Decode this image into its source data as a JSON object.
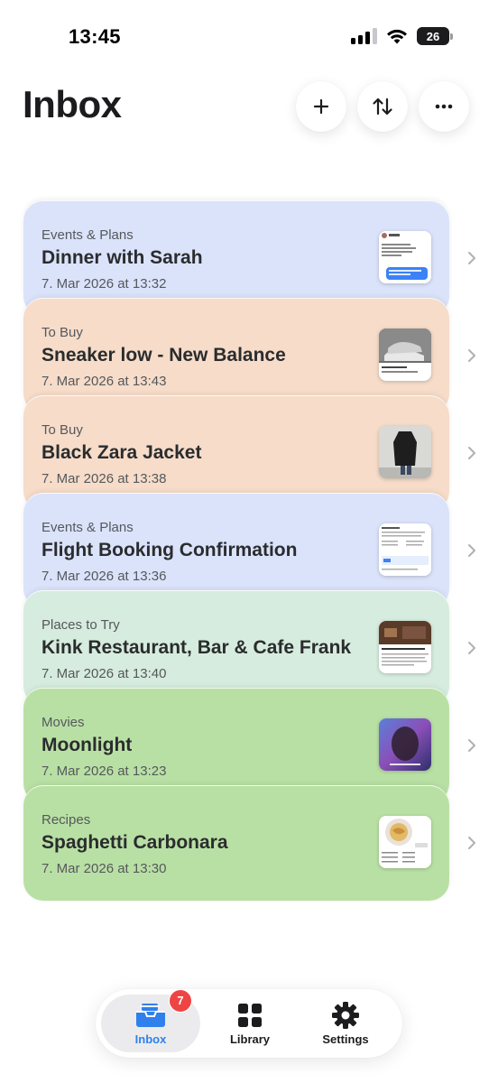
{
  "status_bar": {
    "time": "13:45",
    "battery": "26"
  },
  "header": {
    "title": "Inbox"
  },
  "items": [
    {
      "category": "Events & Plans",
      "title": "Dinner with Sarah",
      "date": "7. Mar 2026 at 13:32",
      "color": "#dbe3fb",
      "thumb": "chat-screenshot"
    },
    {
      "category": "To Buy",
      "title": "Sneaker low - New Balance",
      "date": "7. Mar 2026 at 13:43",
      "color": "#f6dcc9",
      "thumb": "sneaker-photo"
    },
    {
      "category": "To Buy",
      "title": "Black Zara Jacket",
      "date": "7. Mar 2026 at 13:38",
      "color": "#f6dcc9",
      "thumb": "jacket-photo"
    },
    {
      "category": "Events & Plans",
      "title": "Flight Booking Confirmation",
      "date": "7. Mar 2026 at 13:36",
      "color": "#dbe3fb",
      "thumb": "flight-document"
    },
    {
      "category": "Places to Try",
      "title": "Kink Restaurant, Bar & Cafe Frank",
      "date": "7. Mar 2026 at 13:40",
      "color": "#d6ecde",
      "thumb": "restaurant-photo"
    },
    {
      "category": "Movies",
      "title": "Moonlight",
      "date": "7. Mar 2026 at 13:23",
      "color": "#b9e0a4",
      "thumb": "movie-poster"
    },
    {
      "category": "Recipes",
      "title": "Spaghetti Carbonara",
      "date": "7. Mar 2026 at 13:30",
      "color": "#b9e0a4",
      "thumb": "recipe-photo"
    }
  ],
  "tabs": [
    {
      "label": "Inbox",
      "icon": "tray-icon",
      "active": true,
      "badge": "7"
    },
    {
      "label": "Library",
      "icon": "grid-icon",
      "active": false
    },
    {
      "label": "Settings",
      "icon": "gear-icon",
      "active": false
    }
  ],
  "colors": {
    "accent": "#2f80ed",
    "badge": "#ef4444"
  }
}
